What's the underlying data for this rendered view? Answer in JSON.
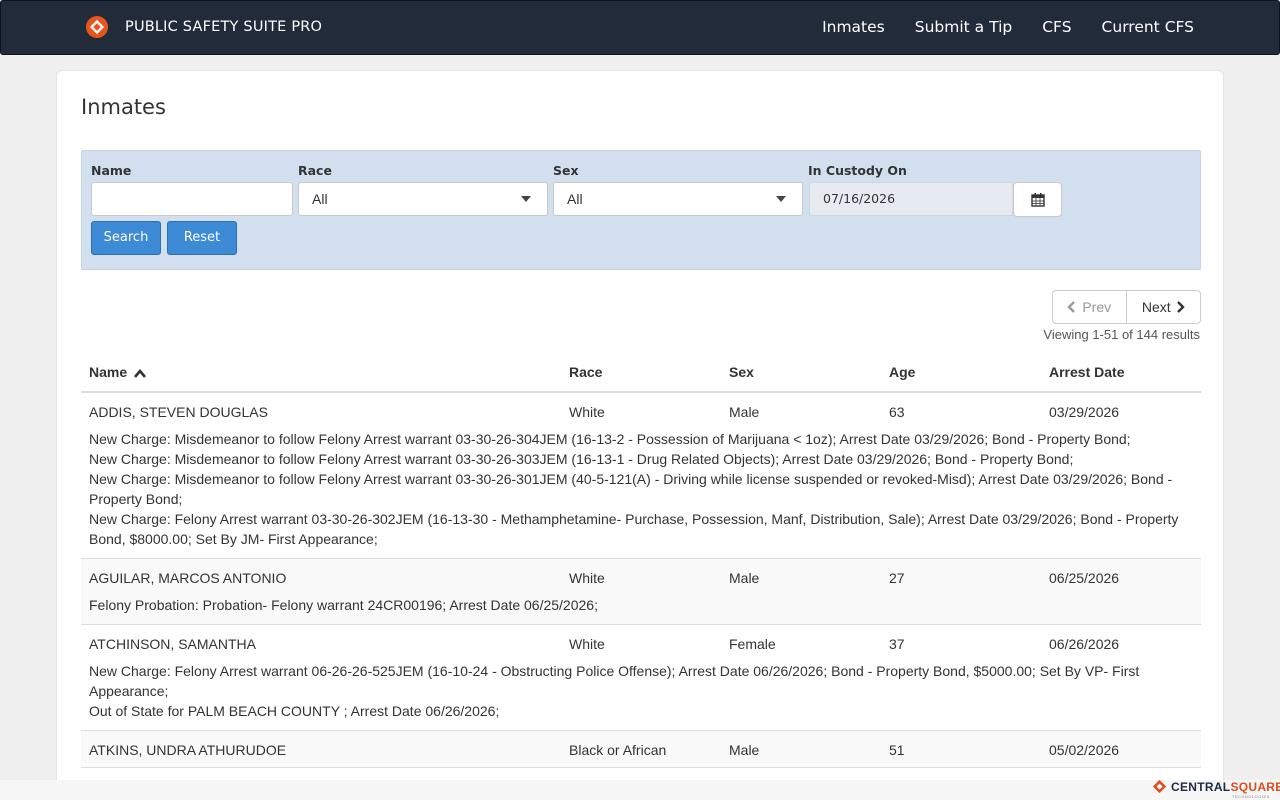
{
  "app": {
    "title": "PUBLIC SAFETY SUITE PRO",
    "nav": [
      "Inmates",
      "Submit a Tip",
      "CFS",
      "Current CFS"
    ]
  },
  "page": {
    "title": "Inmates"
  },
  "filters": {
    "name_label": "Name",
    "name_value": "",
    "race_label": "Race",
    "race_value": "All",
    "sex_label": "Sex",
    "sex_value": "All",
    "custody_label": "In Custody On",
    "custody_value": "07/16/2026",
    "search_label": "Search",
    "reset_label": "Reset"
  },
  "pager": {
    "prev": "Prev",
    "next": "Next",
    "viewing": "Viewing 1-51 of 144 results"
  },
  "table": {
    "headers": [
      "Name",
      "Race",
      "Sex",
      "Age",
      "Arrest Date"
    ],
    "rows": [
      {
        "name": "ADDIS, STEVEN DOUGLAS",
        "race": "White",
        "sex": "Male",
        "age": "63",
        "arrest_date": "03/29/2026",
        "details": [
          "New Charge: Misdemeanor to follow Felony Arrest warrant 03-30-26-304JEM (16-13-2 - Possession of Marijuana < 1oz); Arrest Date 03/29/2026; Bond - Property Bond;",
          "New Charge: Misdemeanor to follow Felony Arrest warrant 03-30-26-303JEM (16-13-1 - Drug Related Objects); Arrest Date 03/29/2026; Bond - Property Bond;",
          "New Charge: Misdemeanor to follow Felony Arrest warrant 03-30-26-301JEM (40-5-121(A) - Driving while license suspended or revoked-Misd); Arrest Date 03/29/2026; Bond - Property Bond;",
          "New Charge: Felony Arrest warrant 03-30-26-302JEM (16-13-30 - Methamphetamine- Purchase, Possession, Manf, Distribution, Sale); Arrest Date 03/29/2026; Bond - Property Bond, $8000.00; Set By JM- First Appearance;"
        ]
      },
      {
        "name": "AGUILAR, MARCOS ANTONIO",
        "race": "White",
        "sex": "Male",
        "age": "27",
        "arrest_date": "06/25/2026",
        "details": [
          "Felony Probation: Probation- Felony warrant 24CR00196; Arrest Date 06/25/2026;"
        ]
      },
      {
        "name": "ATCHINSON, SAMANTHA",
        "race": "White",
        "sex": "Female",
        "age": "37",
        "arrest_date": "06/26/2026",
        "details": [
          "New Charge: Felony Arrest warrant 06-26-26-525JEM (16-10-24 - Obstructing Police Offense); Arrest Date 06/26/2026; Bond - Property Bond, $5000.00; Set By VP- First Appearance;",
          "Out of State for PALM BEACH COUNTY ; Arrest Date 06/26/2026;"
        ]
      },
      {
        "name": "ATKINS, UNDRA ATHURUDOE",
        "race": "Black or African",
        "sex": "Male",
        "age": "51",
        "arrest_date": "05/02/2026",
        "details": []
      }
    ]
  },
  "footer": {
    "brand_a": "CENTRAL",
    "brand_b": "SQUARE",
    "sub": "TECHNOLOGIES"
  },
  "colors": {
    "navbar": "#222b3a",
    "filter_panel": "#d2dfee",
    "primary_button": "#3d8ad6",
    "logo_orange": "#e8561c"
  },
  "icons": {
    "brand": "brand-logo-icon",
    "calendar": "calendar-icon",
    "sort": "sort-ascending-icon",
    "prev": "chevron-left-icon",
    "next": "chevron-right-icon"
  }
}
